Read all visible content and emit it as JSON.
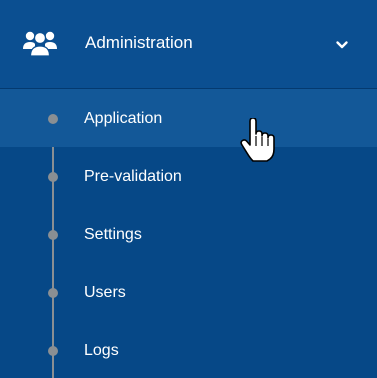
{
  "colors": {
    "background": "#064887",
    "header_background": "#0b4f91",
    "active_item_background": "#135898",
    "tree_line": "#8a8f93",
    "text": "#ffffff"
  },
  "menu": {
    "icon": "users-icon",
    "title": "Administration",
    "expand_icon": "chevron-down-icon",
    "expanded": true,
    "items": [
      {
        "label": "Application",
        "active": true
      },
      {
        "label": "Pre-validation",
        "active": false
      },
      {
        "label": "Settings",
        "active": false
      },
      {
        "label": "Users",
        "active": false
      },
      {
        "label": "Logs",
        "active": false
      }
    ]
  },
  "cursor": "hand-pointer-icon"
}
